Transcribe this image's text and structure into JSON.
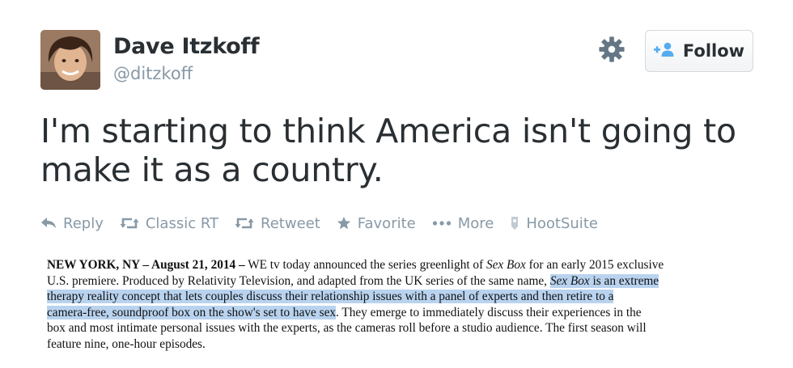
{
  "profile": {
    "name": "Dave Itzkoff",
    "handle": "@ditzkoff"
  },
  "header": {
    "follow_label": "Follow"
  },
  "tweet": {
    "text": "I'm starting to think America isn't going to make it as a country."
  },
  "actions": [
    {
      "label": "Reply",
      "icon": "reply-icon"
    },
    {
      "label": "Classic RT",
      "icon": "retweet-icon"
    },
    {
      "label": "Retweet",
      "icon": "retweet-icon"
    },
    {
      "label": "Favorite",
      "icon": "star-icon"
    },
    {
      "label": "More",
      "icon": "more-dots-icon"
    },
    {
      "label": "HootSuite",
      "icon": "hootsuite-icon"
    }
  ],
  "press_release": {
    "dateline": "NEW YORK, NY – August 21, 2014 –",
    "l1_text": " WE tv today announced the series greenlight of ",
    "l1_italic": "Sex Box",
    "l1_end": " for an early 2015 exclusive",
    "l2_text": "U.S. premiere.  Produced by Relativity Television, and adapted from the UK series of the same name, ",
    "l2_hl_italic": "Sex Box",
    "l2_hl_text": " is an extreme",
    "l3_hl": "therapy reality concept that lets couples discuss their relationship issues with a panel of experts and then retire to a",
    "l4_hl": "camera-free, soundproof box on the show's set to have sex",
    "l4_rest": ". They emerge to immediately discuss their experiences in the",
    "l5": "box and most intimate personal issues with the experts, as the cameras roll before a studio audience.  The first season will",
    "l6": "feature nine, one-hour episodes."
  },
  "colors": {
    "text": "#292f33",
    "muted": "#8899a6",
    "follow_icon": "#55acee",
    "highlight": "#b9d3ef"
  }
}
